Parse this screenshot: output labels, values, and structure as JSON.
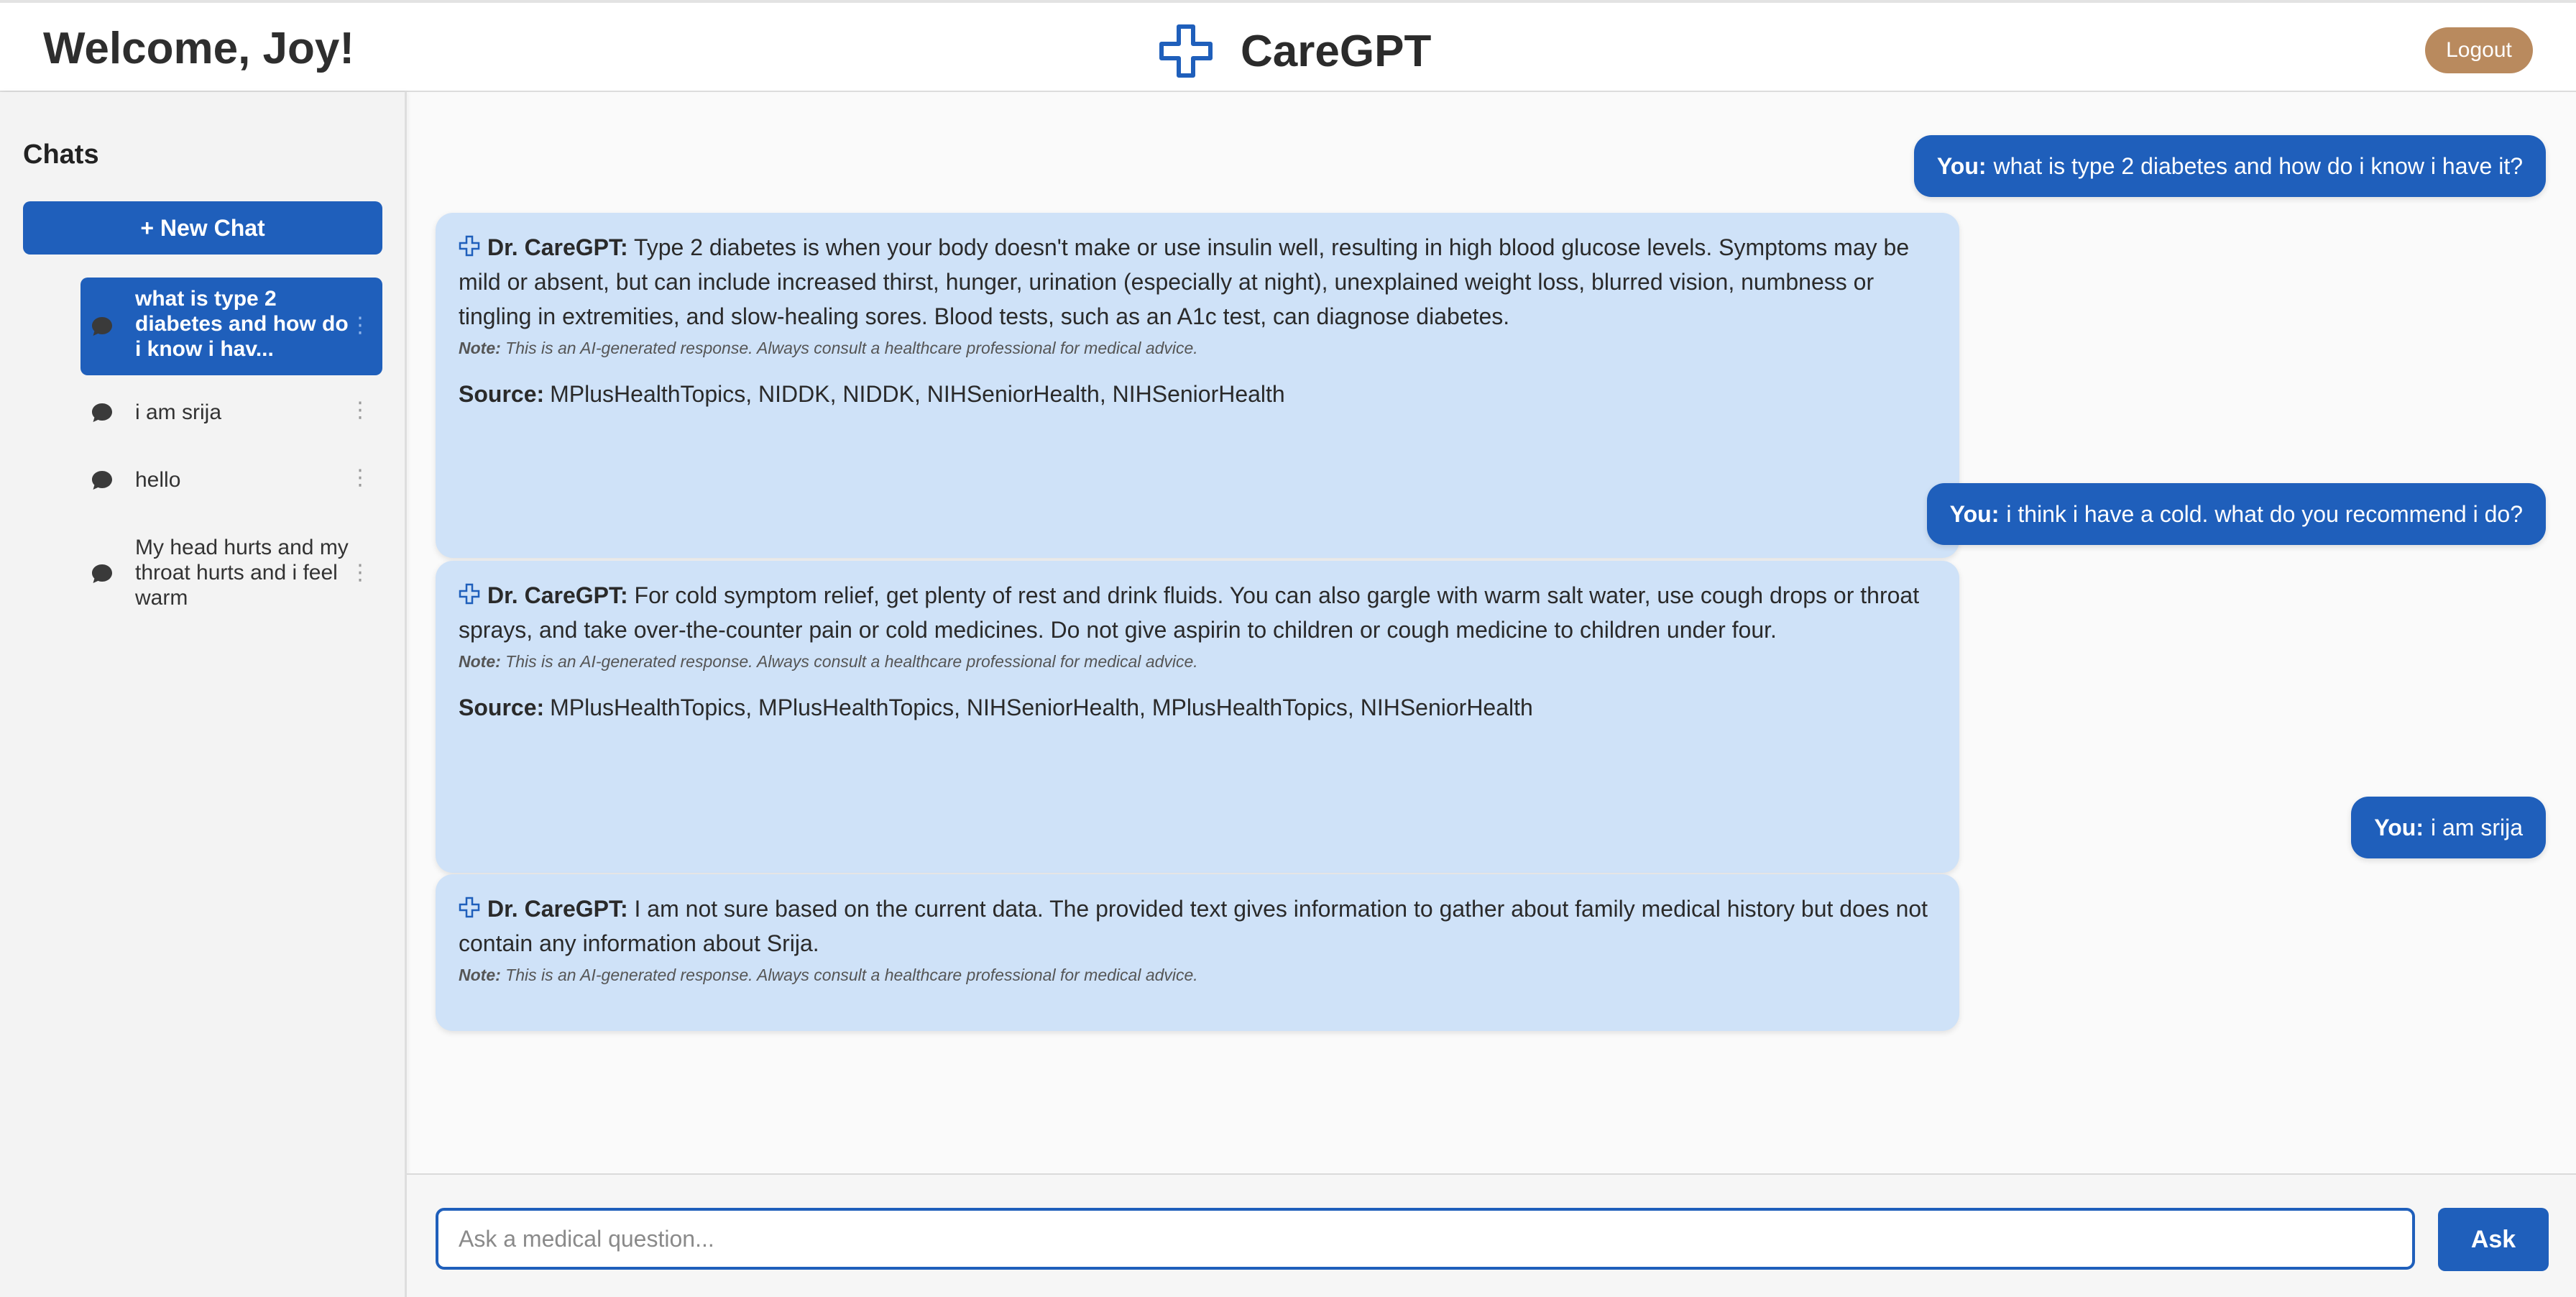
{
  "header": {
    "welcome": "Welcome, Joy!",
    "brand": "CareGPT",
    "logout_label": "Logout",
    "brand_icon": "medical-cross-icon"
  },
  "sidebar": {
    "title": "Chats",
    "new_chat_label": "+ New Chat",
    "items": [
      {
        "label": "what is type 2 diabetes and how do i know i hav...",
        "active": true
      },
      {
        "label": "i am srija",
        "active": false
      },
      {
        "label": "hello",
        "active": false
      },
      {
        "label": "My head hurts and my throat hurts and i feel warm",
        "active": false
      }
    ],
    "kebab": "⋮"
  },
  "conversation": {
    "user_prefix": "You:",
    "bot_prefix": "Dr. CareGPT:",
    "note_prefix": "Note:",
    "note_text": "This is an AI-generated response. Always consult a healthcare professional for medical advice.",
    "source_prefix": "Source:",
    "messages": [
      {
        "role": "user",
        "text": "what is type 2 diabetes and how do i know i have it?"
      },
      {
        "role": "bot",
        "text": "Type 2 diabetes is when your body doesn't make or use insulin well, resulting in high blood glucose levels. Symptoms may be mild or absent, but can include increased thirst, hunger, urination (especially at night), unexplained weight loss, blurred vision, numbness or tingling in extremities, and slow-healing sores. Blood tests, such as an A1c test, can diagnose diabetes.",
        "source": "MPlusHealthTopics, NIDDK, NIDDK, NIHSeniorHealth, NIHSeniorHealth"
      },
      {
        "role": "user",
        "text": "i think i have a cold. what do you recommend i do?"
      },
      {
        "role": "bot",
        "text": "For cold symptom relief, get plenty of rest and drink fluids. You can also gargle with warm salt water, use cough drops or throat sprays, and take over-the-counter pain or cold medicines. Do not give aspirin to children or cough medicine to children under four.",
        "source": "MPlusHealthTopics, MPlusHealthTopics, NIHSeniorHealth, MPlusHealthTopics, NIHSeniorHealth"
      },
      {
        "role": "user",
        "text": "i am srija"
      },
      {
        "role": "bot",
        "text": "I am not sure based on the current data. The provided text gives information to gather about family medical history but does not contain any information about Srija."
      }
    ]
  },
  "composer": {
    "placeholder": "Ask a medical question...",
    "value": "",
    "ask_label": "Ask"
  },
  "colors": {
    "primary": "#1f5fbb",
    "bot_bubble": "#cfe2f8",
    "logout": "#b98a5e"
  }
}
